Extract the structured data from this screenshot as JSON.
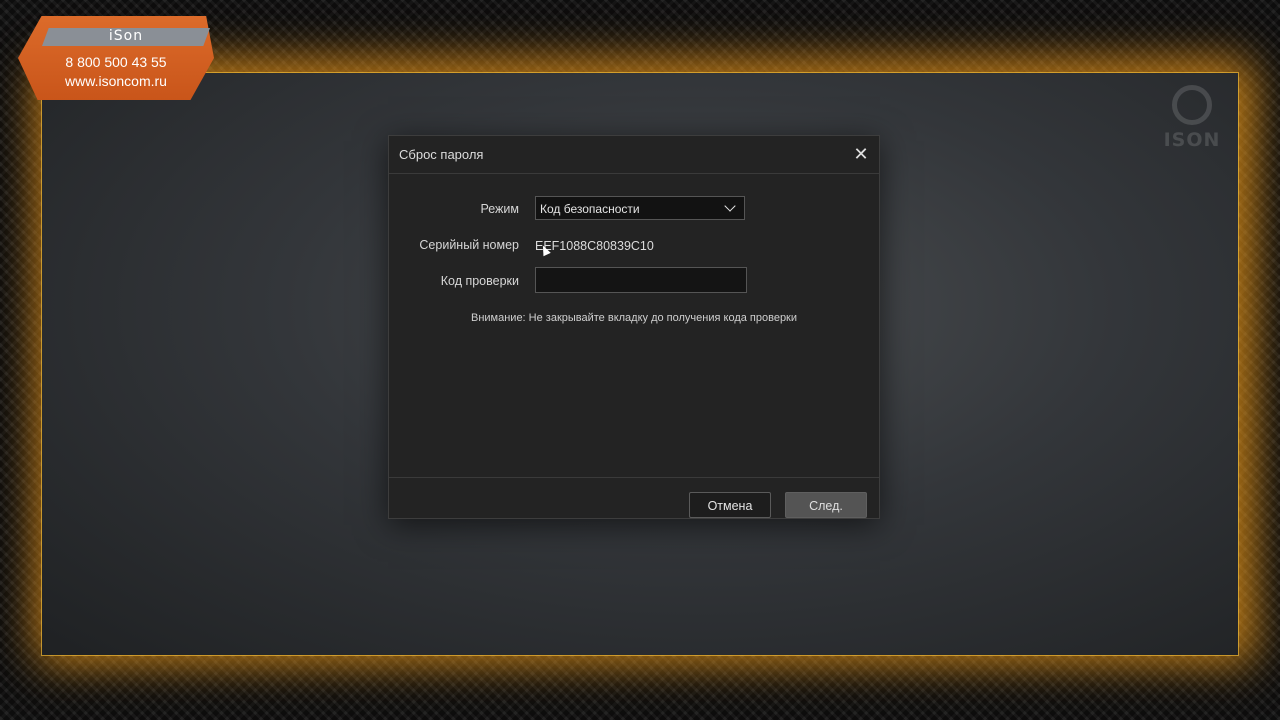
{
  "badge": {
    "brand": "iSon",
    "phone": "8 800 500 43 55",
    "site": "www.isoncom.ru"
  },
  "watermark": {
    "text": "ISON"
  },
  "dialog": {
    "title": "Сброс пароля",
    "close_icon": "close-icon",
    "fields": {
      "mode_label": "Режим",
      "mode_value": "Код безопасности",
      "serial_label": "Серийный номер",
      "serial_value": "EEF1088C80839C10",
      "code_label": "Код проверки",
      "code_value": "",
      "code_placeholder": ""
    },
    "notice": "Внимание: Не закрывайте вкладку до получения кода проверки",
    "buttons": {
      "cancel": "Отмена",
      "next": "След."
    }
  },
  "colors": {
    "accent_orange": "#dc6b2a",
    "dialog_bg": "#232323",
    "glow": "#ffaa1e"
  }
}
